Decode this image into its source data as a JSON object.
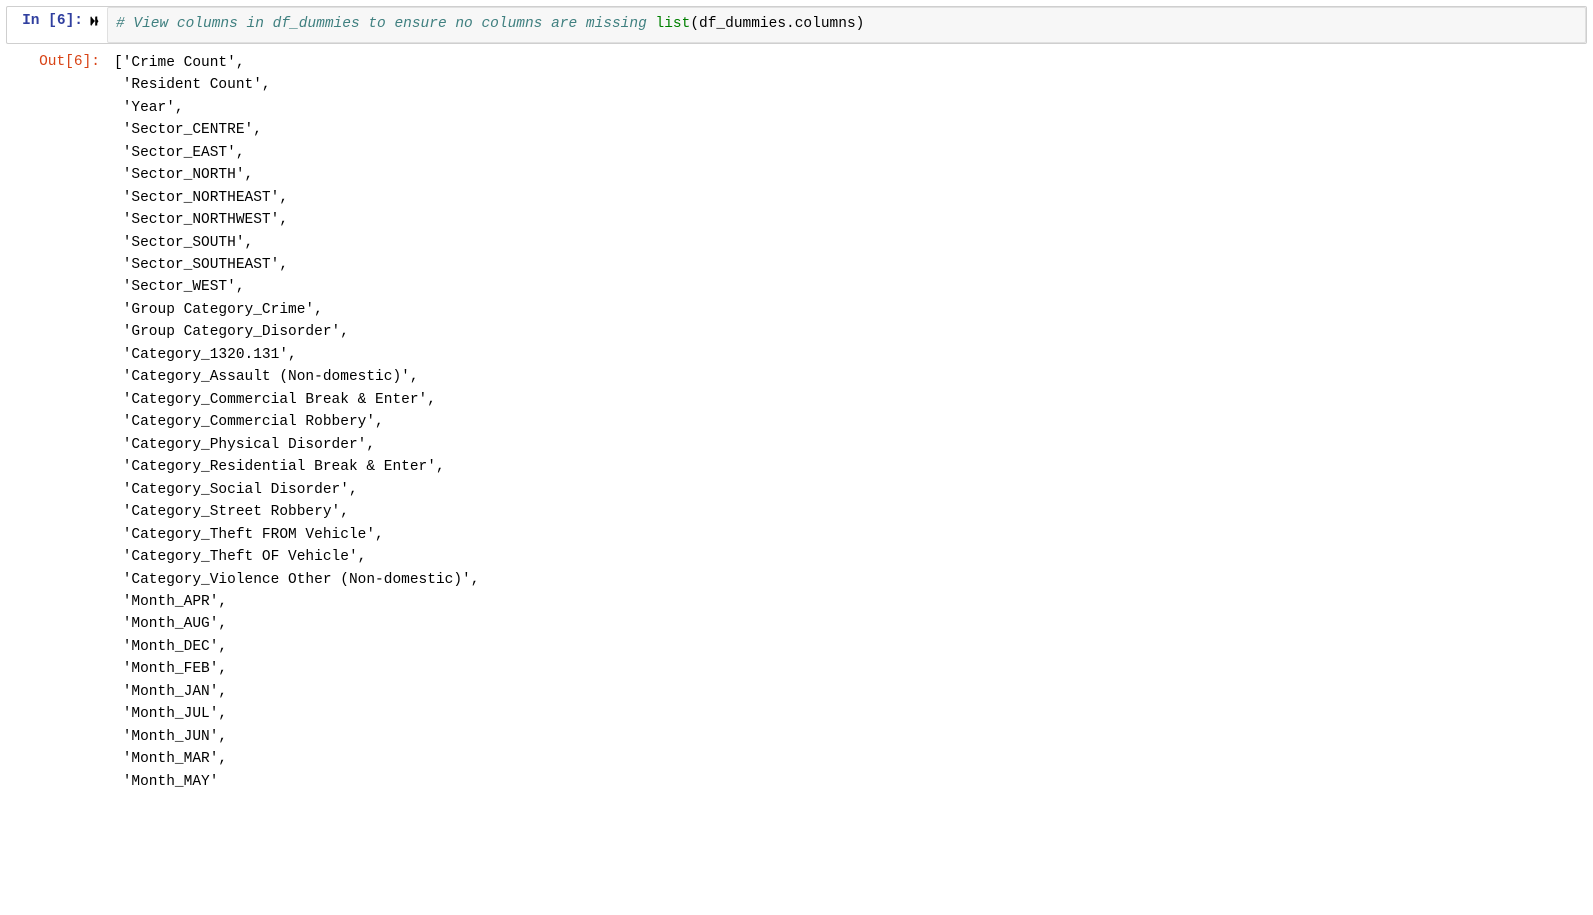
{
  "cell": {
    "in_prompt": "In [6]:",
    "out_prompt": "Out[6]:",
    "code": {
      "comment": "# View columns in df_dummies to ensure no columns are missing",
      "builtin": "list",
      "open_paren": "(",
      "var": "df_dummies",
      "dot": ".",
      "attr": "columns",
      "close_paren": ")"
    },
    "output_columns": [
      "Crime Count",
      "Resident Count",
      "Year",
      "Sector_CENTRE",
      "Sector_EAST",
      "Sector_NORTH",
      "Sector_NORTHEAST",
      "Sector_NORTHWEST",
      "Sector_SOUTH",
      "Sector_SOUTHEAST",
      "Sector_WEST",
      "Group Category_Crime",
      "Group Category_Disorder",
      "Category_1320.131",
      "Category_Assault (Non-domestic)",
      "Category_Commercial Break & Enter",
      "Category_Commercial Robbery",
      "Category_Physical Disorder",
      "Category_Residential Break & Enter",
      "Category_Social Disorder",
      "Category_Street Robbery",
      "Category_Theft FROM Vehicle",
      "Category_Theft OF Vehicle",
      "Category_Violence Other (Non-domestic)",
      "Month_APR",
      "Month_AUG",
      "Month_DEC",
      "Month_FEB",
      "Month_JAN",
      "Month_JUL",
      "Month_JUN",
      "Month_MAR",
      "Month_MAY"
    ],
    "output_truncated_last": true
  }
}
